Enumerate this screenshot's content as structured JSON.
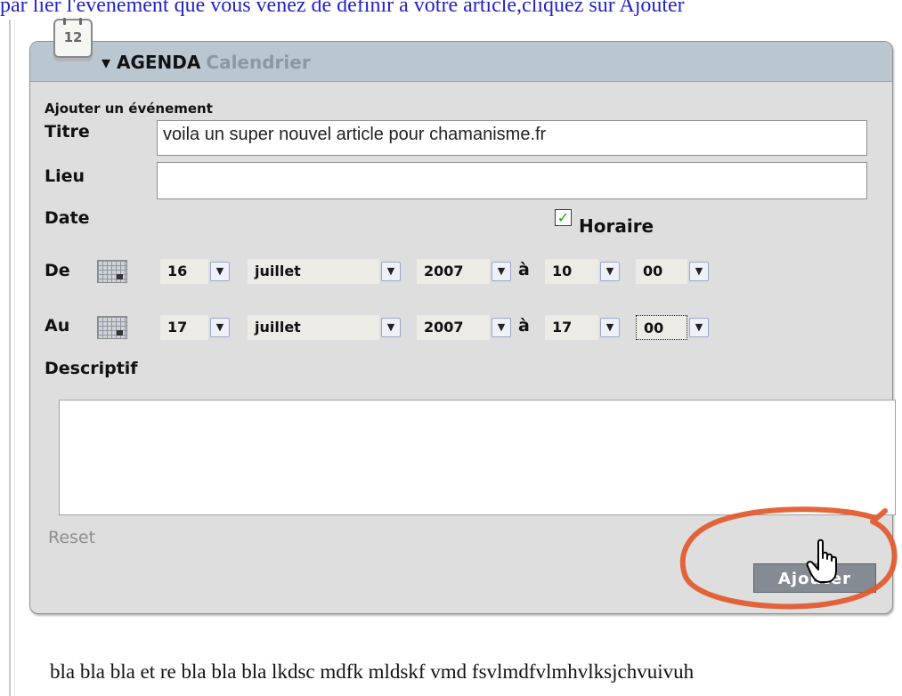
{
  "top_instruction": "par lier l'évènement que vous venez de définir à votre article,cliquez sur Ajouter",
  "panel": {
    "icon_day": "12",
    "title": "▾ AGENDA",
    "title_sub": "Calendrier",
    "subtitle": "Ajouter un événement"
  },
  "form": {
    "titre_label": "Titre",
    "titre_value": "voila un super nouvel article pour chamanisme.fr",
    "lieu_label": "Lieu",
    "lieu_value": "",
    "date_label": "Date",
    "horaire_label": "Horaire",
    "horaire_checked": true,
    "de_label": "De",
    "au_label": "Au",
    "a_sep": "à",
    "descriptif_label": "Descriptif",
    "reset_label": "Reset",
    "submit_label": "Ajouter"
  },
  "de": {
    "day": "16",
    "month": "juillet",
    "year": "2007",
    "hour": "10",
    "minute": "00"
  },
  "au": {
    "day": "17",
    "month": "juillet",
    "year": "2007",
    "hour": "17",
    "minute": "00"
  },
  "icons": {
    "calendar_header": "calendar-page-icon",
    "date_picker": "calendar-grid-icon",
    "dropdown": "chevron-down-icon",
    "cursor": "hand-pointer-icon",
    "checkbox": "check-icon"
  },
  "colors": {
    "header_bar": "#bac7d1",
    "button": "#848b92",
    "annotation": "#e2582a",
    "link": "#2222cc"
  },
  "bottom_text": "bla bla bla et re bla bla bla lkdsc mdfk mldskf vmd fsvlmdfvlmhvlksjchvuivuh"
}
